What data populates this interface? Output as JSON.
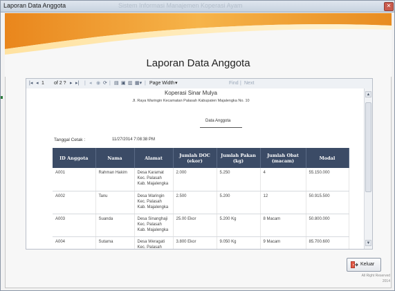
{
  "window": {
    "title": "Laporan Data Anggota",
    "ghost_title": "Sistem Informasi Manajemen Koperasi Ayam",
    "close_label": "✕"
  },
  "colors": {
    "header_orange": "#f2a02e",
    "header_band_light": "#ffd27a",
    "table_header_bg": "#3b4b66",
    "table_header_text": "#ffffff"
  },
  "heading": "Laporan Data Anggota",
  "toolbar": {
    "first_icon": "first-page-icon",
    "prev_icon": "previous-page-icon",
    "page_current": "1",
    "page_total_label": "of 2 ?",
    "next_icon": "next-page-icon",
    "last_icon": "last-page-icon",
    "zoom_value": "Page Width",
    "find_label": "Find",
    "separator": "|",
    "next_label": "Next"
  },
  "report": {
    "company": "Koperasi Sinar Mulya",
    "address": "Jl. Raya Waringin Kecamatan Palasah Kabupaten Majalengka No. 10",
    "subtitle": "Data Anggota",
    "tanggal_label": "Tanggal Cetak :",
    "tanggal_value": "11/27/2014 7:08:38 PM",
    "columns": [
      "ID Anggota",
      "Nama",
      "Alamat",
      "Jumlah DOC (ekor)",
      "Jumlah Pakan (kg)",
      "Jumlah Obat (macam)",
      "Modal"
    ],
    "rows": [
      {
        "id": "A001",
        "nama": "Rahman Hakim",
        "alamat": "Desa Karamat Kec. Palasah Kab. Majalengka",
        "doc": "2.000",
        "pakan": "5.250",
        "obat": "4",
        "modal": "55.150.000"
      },
      {
        "id": "A002",
        "nama": "Tanu",
        "alamat": "Desa Waringin Kec. Palasah Kab. Majalengka",
        "doc": "2.500",
        "pakan": "5.200",
        "obat": "12",
        "modal": "50.915.500"
      },
      {
        "id": "A003",
        "nama": "Suanda",
        "alamat": "Desa Sinanghaji Kec. Palasah Kab. Majalengka",
        "doc": "25.00 Ekor",
        "pakan": "5.200 Kg",
        "obat": "8 Macam",
        "modal": "50.800.000"
      },
      {
        "id": "A004",
        "nama": "Sutarna",
        "alamat": "Desa Weragati Kec. Palasah Kab.",
        "doc": "3.800 Ekor",
        "pakan": "9.050 Kg",
        "obat": "9 Macam",
        "modal": "85.700.600"
      }
    ]
  },
  "keluar_button": {
    "label": "Keluar",
    "icon": "exit-door-icon"
  },
  "footer": {
    "line1": "All Right Reserved",
    "line2": "2014"
  }
}
